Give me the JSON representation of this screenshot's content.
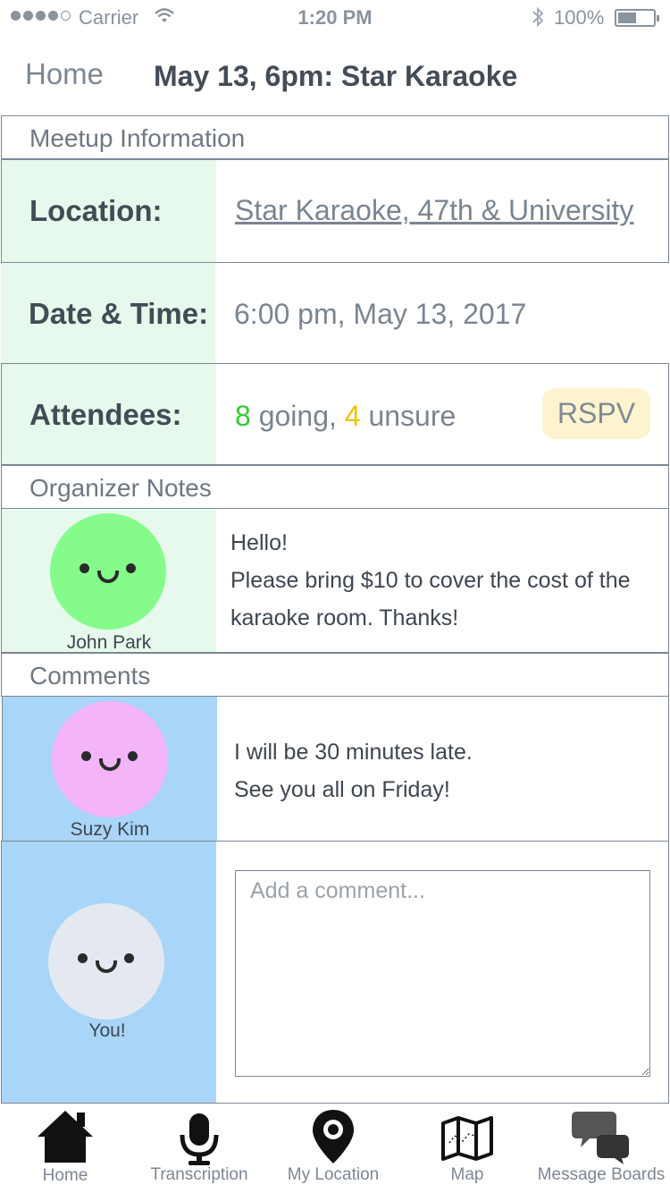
{
  "status_bar": {
    "carrier": "Carrier",
    "time": "1:20 PM",
    "battery": "100%"
  },
  "nav": {
    "back_label": "Home",
    "title": "May 13, 6pm: Star Karaoke"
  },
  "meetup": {
    "section_title": "Meetup Information",
    "location_label": "Location:",
    "location_value": "Star Karaoke, 47th & University",
    "datetime_label": "Date & Time:",
    "datetime_value": "6:00 pm, May 13, 2017",
    "attendees_label": "Attendees:",
    "going_count": "8",
    "going_text": " going, ",
    "unsure_count": "4",
    "unsure_text": " unsure",
    "rsvp_label": "RSPV"
  },
  "organizer_notes": {
    "section_title": "Organizer Notes",
    "author": "John Park",
    "avatar_color": "#85fc8a",
    "lines": [
      "Hello!",
      "Please bring $10 to cover the cost of the",
      "karaoke room. Thanks!"
    ]
  },
  "comments": {
    "section_title": "Comments",
    "items": [
      {
        "author": "Suzy Kim",
        "avatar_color": "#f3b4f8",
        "lines": [
          "I will be 30 minutes late.",
          "See you all on Friday!"
        ]
      }
    ],
    "you": {
      "author": "You!",
      "avatar_color": "#e4e9f1",
      "placeholder": "Add a comment..."
    }
  },
  "tabs": [
    {
      "label": "Home",
      "icon": "home-icon"
    },
    {
      "label": "Transcription",
      "icon": "microphone-icon"
    },
    {
      "label": "My Location",
      "icon": "location-pin-icon"
    },
    {
      "label": "Map",
      "icon": "map-icon"
    },
    {
      "label": "Message Boards",
      "icon": "chat-bubbles-icon"
    }
  ]
}
